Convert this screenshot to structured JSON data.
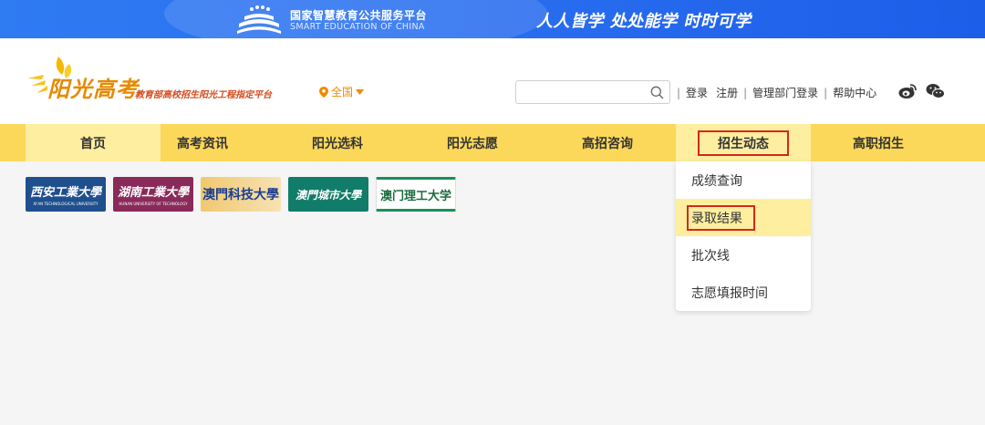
{
  "banner": {
    "platform_cn": "国家智慧教育公共服务平台",
    "platform_en": "SMART EDUCATION OF CHINA",
    "slogan": "人人皆学 处处能学 时时可学"
  },
  "header": {
    "brand": "阳光高考",
    "brand_sub": "教育部高校招生阳光工程指定平台",
    "region": "全国",
    "search": {
      "value": "",
      "placeholder": ""
    },
    "links": [
      "登录",
      "注册",
      "管理部门登录",
      "帮助中心"
    ],
    "social_icons": [
      "weibo-icon",
      "wechat-icon"
    ]
  },
  "nav": {
    "items": [
      "首页",
      "高考资讯",
      "阳光选科",
      "阳光志愿",
      "高招咨询",
      "招生动态",
      "高职招生"
    ],
    "active": "招生动态"
  },
  "dropdown": {
    "items": [
      "成绩查询",
      "录取结果",
      "批次线",
      "志愿填报时间"
    ],
    "highlighted": "录取结果"
  },
  "universities": [
    {
      "name": "西安工業大學",
      "en": "XI'AN TECHNOLOGICAL UNIVERSITY"
    },
    {
      "name": "湖南工業大學",
      "en": "HUNAN UNIVERSITY OF TECHNOLOGY"
    },
    {
      "name": "澳門科技大學"
    },
    {
      "name": "澳門城市大學"
    },
    {
      "name": "澳门理工大学"
    }
  ],
  "colors": {
    "banner_blue": "#2a6ff0",
    "nav_yellow": "#fcd85a",
    "nav_highlight": "#fdeea0",
    "annotation_red": "#d8261c",
    "brand_orange": "#e68a00"
  }
}
